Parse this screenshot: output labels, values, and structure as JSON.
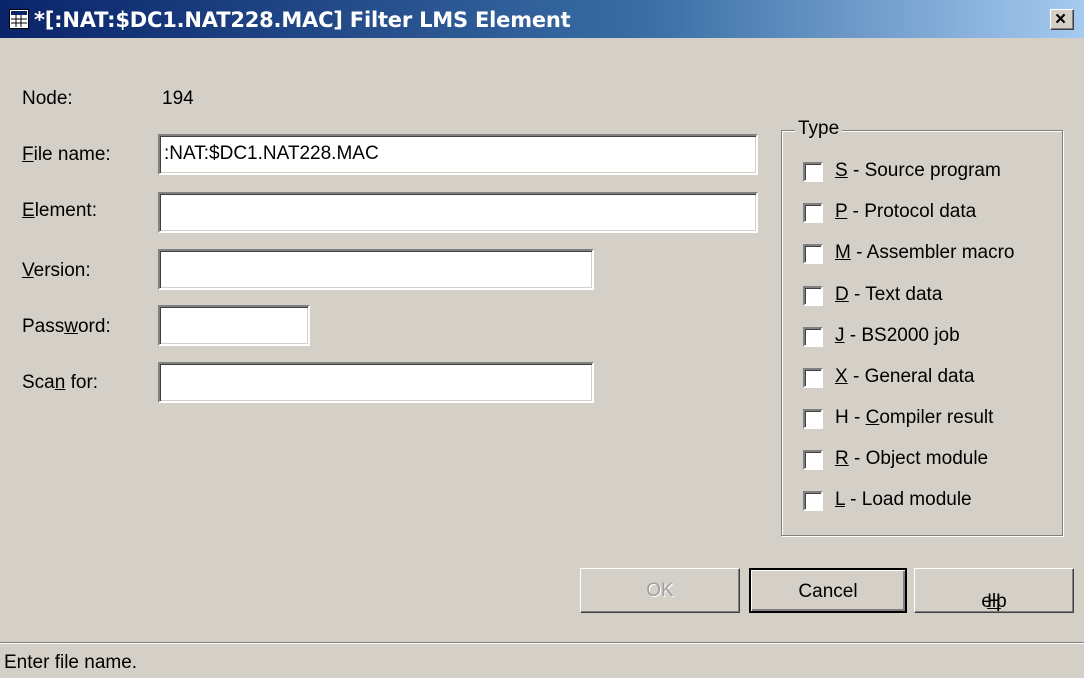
{
  "window": {
    "title": "*[:NAT:$DC1.NAT228.MAC] Filter LMS Element",
    "close_glyph": "×"
  },
  "form": {
    "node_label": "Node:",
    "node_value": "194",
    "file_name_label_pre": "",
    "file_name_label_u": "F",
    "file_name_label_post": "ile name:",
    "file_name_value": ":NAT:$DC1.NAT228.MAC",
    "element_label_u": "E",
    "element_label_post": "lement:",
    "element_value": "",
    "version_label_u": "V",
    "version_label_post": "ersion:",
    "version_value": "",
    "password_label_pre": "Pass",
    "password_label_u": "w",
    "password_label_post": "ord:",
    "password_value": "",
    "scan_label_pre": "Sca",
    "scan_label_u": "n",
    "scan_label_post": " for:",
    "scan_value": ""
  },
  "type_group": {
    "title": "Type",
    "items": [
      {
        "key": "S",
        "text": " - Source program",
        "checked": false
      },
      {
        "key": "P",
        "text": " - Protocol data",
        "checked": false
      },
      {
        "key": "M",
        "text": " - Assembler macro",
        "checked": false
      },
      {
        "key": "D",
        "text": " - Text data",
        "checked": false
      },
      {
        "key": "J",
        "text": " - BS2000 job",
        "checked": false
      },
      {
        "key": "X",
        "text": " - General data",
        "checked": false
      },
      {
        "pre": "H - ",
        "key": "C",
        "text": "ompiler result",
        "checked": false
      },
      {
        "key": "R",
        "text": " - Object module",
        "checked": false
      },
      {
        "key": "L",
        "text": " - Load module",
        "checked": false
      }
    ]
  },
  "buttons": {
    "ok": "OK",
    "cancel": "Cancel",
    "help_u": "H",
    "help_post": "elp"
  },
  "status": {
    "text": "Enter file name."
  },
  "icons": {
    "app": "grid-window-icon",
    "close": "close-icon",
    "checkbox": "checkbox-icon"
  }
}
